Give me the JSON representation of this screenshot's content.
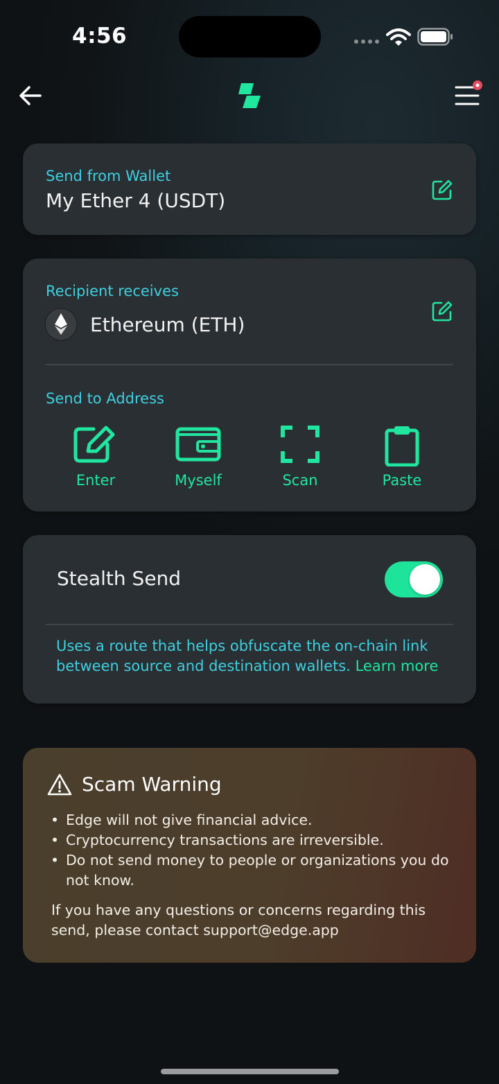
{
  "status_bar": {
    "time": "4:56"
  },
  "send_from": {
    "label": "Send from Wallet",
    "wallet": "My Ether 4 (USDT)"
  },
  "recipient": {
    "label": "Recipient receives",
    "asset": "Ethereum (ETH)",
    "address_label": "Send to Address",
    "actions": [
      {
        "label": "Enter",
        "icon": "pencil-square-icon"
      },
      {
        "label": "Myself",
        "icon": "wallet-icon"
      },
      {
        "label": "Scan",
        "icon": "scan-frame-icon"
      },
      {
        "label": "Paste",
        "icon": "clipboard-icon"
      }
    ]
  },
  "stealth": {
    "title": "Stealth Send",
    "enabled": true,
    "description": "Uses a route that helps obfuscate the on-chain link between source and destination wallets.",
    "learn_more": "Learn more"
  },
  "scam_warning": {
    "title": "Scam Warning",
    "bullets": [
      "Edge will not give financial advice.",
      "Cryptocurrency transactions are irreversible.",
      "Do not send money to people or organizations you do not know."
    ],
    "footer": "If you have any questions or concerns regarding this send, please contact support@edge.app"
  },
  "colors": {
    "accent": "#20e6a0",
    "label": "#3ed0e0",
    "card": "#2a2f33",
    "badge": "#e84a5f"
  }
}
